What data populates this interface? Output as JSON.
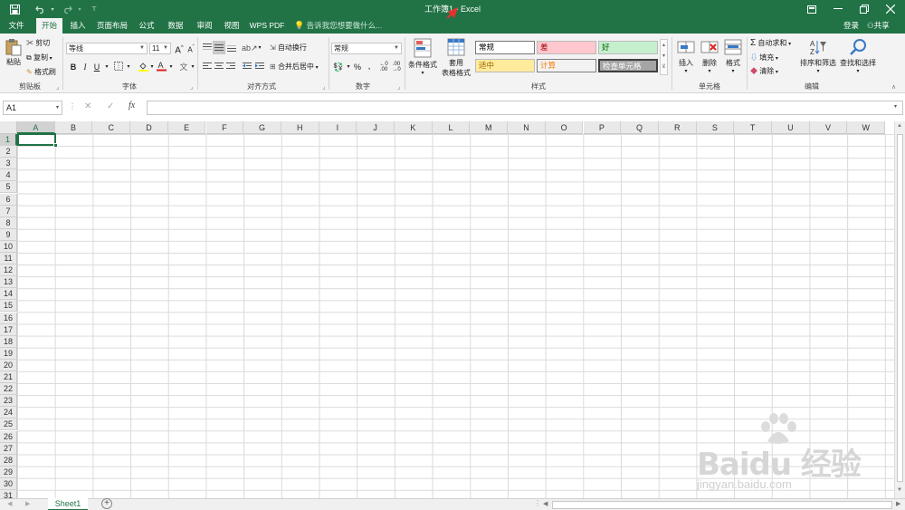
{
  "window": {
    "title": "工作簿1 - Excel",
    "accent_color": "#217346",
    "controls": [
      "ribbon-display-icon",
      "minimize-icon",
      "restore-icon",
      "close-icon"
    ]
  },
  "quick_access": {
    "icons": [
      "save-icon",
      "undo-icon",
      "redo-icon",
      "customize-icon"
    ]
  },
  "tabs": [
    "文件",
    "开始",
    "插入",
    "页面布局",
    "公式",
    "数据",
    "审阅",
    "视图",
    "WPS PDF"
  ],
  "active_tab": "开始",
  "tell_me": "告诉我您想要做什么...",
  "account": {
    "login": "登录",
    "share": "共享"
  },
  "ribbon": {
    "clipboard": {
      "label": "剪贴板",
      "paste": "粘贴",
      "cut": "剪切",
      "copy": "复制",
      "format_painter": "格式刷"
    },
    "font": {
      "label": "字体",
      "font_name": "等线",
      "font_size": "11",
      "bold": "B",
      "italic": "I",
      "underline": "U",
      "grow": "A",
      "shrink": "A"
    },
    "alignment": {
      "label": "对齐方式",
      "wrap": "自动换行",
      "merge": "合并后居中"
    },
    "number": {
      "label": "数字",
      "format": "常规"
    },
    "styles": {
      "label": "样式",
      "conditional": "条件格式",
      "table_format_1": "套用",
      "table_format_2": "表格格式",
      "cells": [
        {
          "text": "常规",
          "bg": "#ffffff",
          "fg": "#000000"
        },
        {
          "text": "差",
          "bg": "#ffc7ce",
          "fg": "#9c0006"
        },
        {
          "text": "好",
          "bg": "#c6efce",
          "fg": "#006100"
        },
        {
          "text": "适中",
          "bg": "#ffeb9c",
          "fg": "#9c6500"
        },
        {
          "text": "计算",
          "bg": "#f2f2f2",
          "fg": "#fa7d00"
        },
        {
          "text": "检查单元格",
          "bg": "#a5a5a5",
          "fg": "#ffffff"
        }
      ]
    },
    "cells_group": {
      "label": "单元格",
      "insert": "插入",
      "delete": "删除",
      "format": "格式"
    },
    "editing": {
      "label": "编辑",
      "autosum": "自动求和",
      "fill": "填充",
      "clear": "清除",
      "sort": "排序和筛选",
      "find": "查找和选择"
    }
  },
  "name_box": "A1",
  "formula": "",
  "columns": [
    "A",
    "B",
    "C",
    "D",
    "E",
    "F",
    "G",
    "H",
    "I",
    "J",
    "K",
    "L",
    "M",
    "N",
    "O",
    "P",
    "Q",
    "R",
    "S",
    "T",
    "U",
    "V",
    "W"
  ],
  "rows": [
    "1",
    "2",
    "3",
    "4",
    "5",
    "6",
    "7",
    "8",
    "9",
    "10",
    "11",
    "12",
    "13",
    "14",
    "15",
    "16",
    "17",
    "18",
    "19",
    "20",
    "21",
    "22",
    "23",
    "24",
    "25",
    "26",
    "27",
    "28",
    "29",
    "30",
    "31"
  ],
  "selected_cell": "A1",
  "sheet_tab": "Sheet1",
  "watermark": {
    "brand": "Baidu 经验",
    "url": "jingyan.baidu.com"
  }
}
